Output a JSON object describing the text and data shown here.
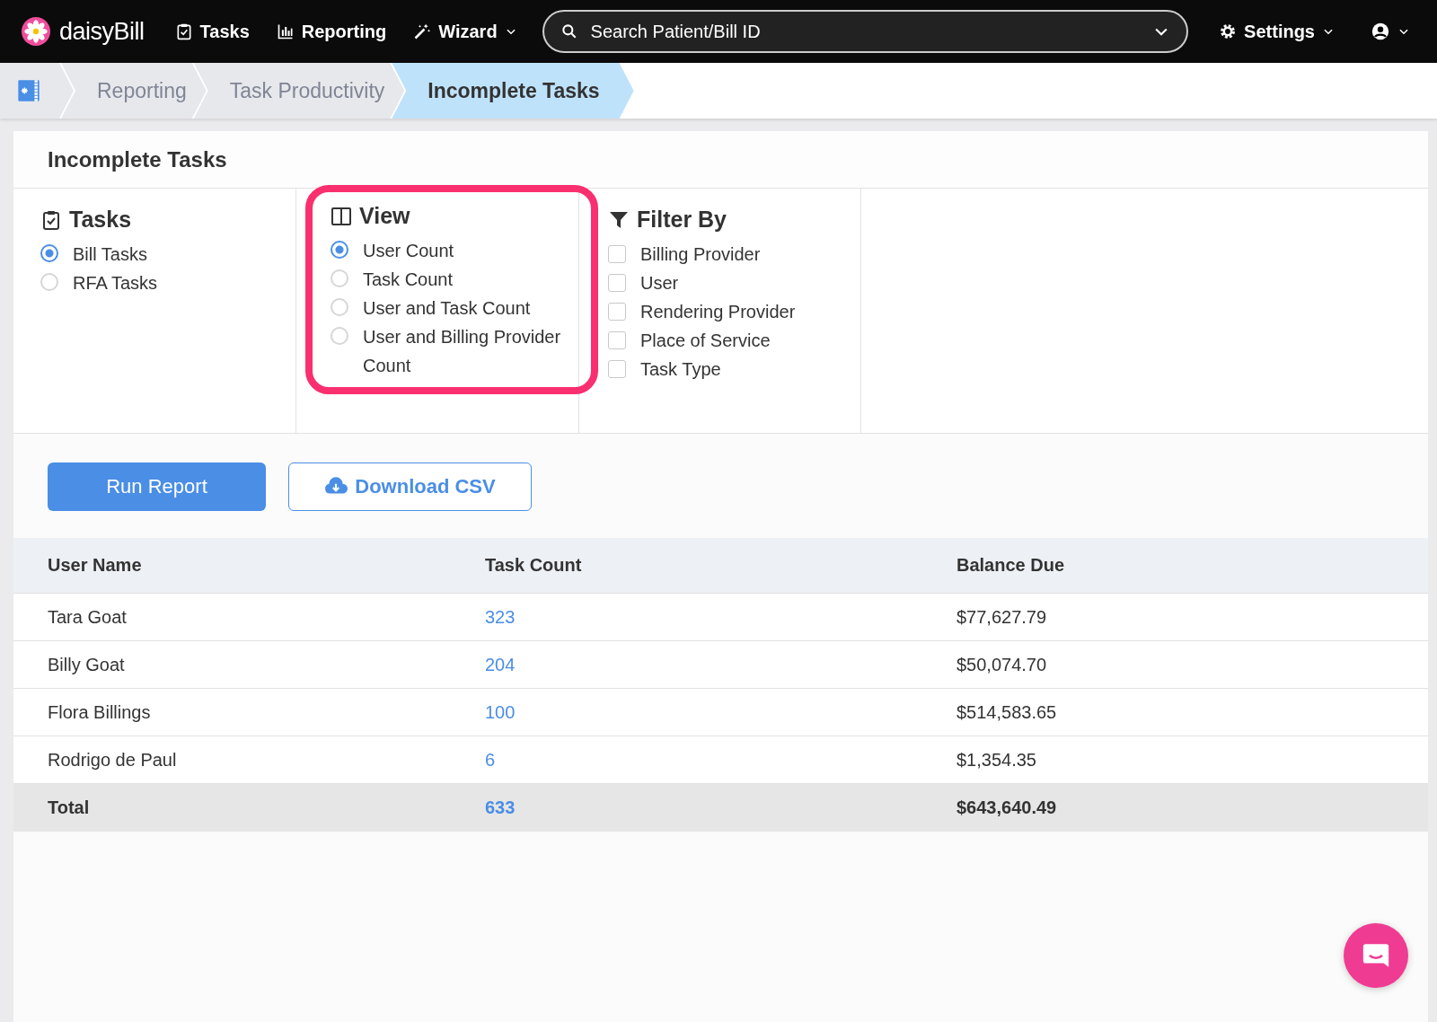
{
  "navbar": {
    "logo": "daisyBill",
    "items": [
      {
        "label": "Tasks"
      },
      {
        "label": "Reporting"
      },
      {
        "label": "Wizard"
      }
    ],
    "search": {
      "placeholder": "Search Patient/Bill ID"
    },
    "settings": {
      "label": "Settings"
    }
  },
  "breadcrumbs": [
    {
      "label": "Reporting",
      "selected": false
    },
    {
      "label": "Task Productivity",
      "selected": false
    },
    {
      "label": "Incomplete Tasks",
      "selected": true
    }
  ],
  "card": {
    "title": "Incomplete Tasks"
  },
  "options": [
    {
      "title": "Tasks",
      "kind": "radio",
      "highlighted": false,
      "items": [
        {
          "label": "Bill Tasks",
          "selected": true
        },
        {
          "label": "RFA Tasks",
          "selected": false
        }
      ]
    },
    {
      "title": "View",
      "kind": "radio",
      "highlighted": true,
      "items": [
        {
          "label": "User Count",
          "selected": true
        },
        {
          "label": "Task Count",
          "selected": false
        },
        {
          "label": "User and Task Count",
          "selected": false
        },
        {
          "label": "User and Billing Provider Count",
          "selected": false
        }
      ]
    },
    {
      "title": "Filter By",
      "kind": "checkbox",
      "highlighted": false,
      "items": [
        {
          "label": "Billing Provider",
          "checked": false
        },
        {
          "label": "User",
          "checked": false
        },
        {
          "label": "Rendering Provider",
          "checked": false
        },
        {
          "label": "Place of Service",
          "checked": false
        },
        {
          "label": "Task Type",
          "checked": false
        }
      ]
    }
  ],
  "buttons": [
    {
      "label": "Run Report",
      "kind": "primary"
    },
    {
      "label": "Download CSV",
      "kind": "outline"
    }
  ],
  "table": {
    "columns": [
      "User Name",
      "Task Count",
      "Balance Due"
    ],
    "rows": [
      [
        "Tara Goat",
        "323",
        "$77,627.79"
      ],
      [
        "Billy Goat",
        "204",
        "$50,074.70"
      ],
      [
        "Flora Billings",
        "100",
        "$514,583.65"
      ],
      [
        "Rodrigo de Paul",
        "6",
        "$1,354.35"
      ]
    ],
    "total": [
      "Total",
      "633",
      "$643,640.49"
    ]
  }
}
